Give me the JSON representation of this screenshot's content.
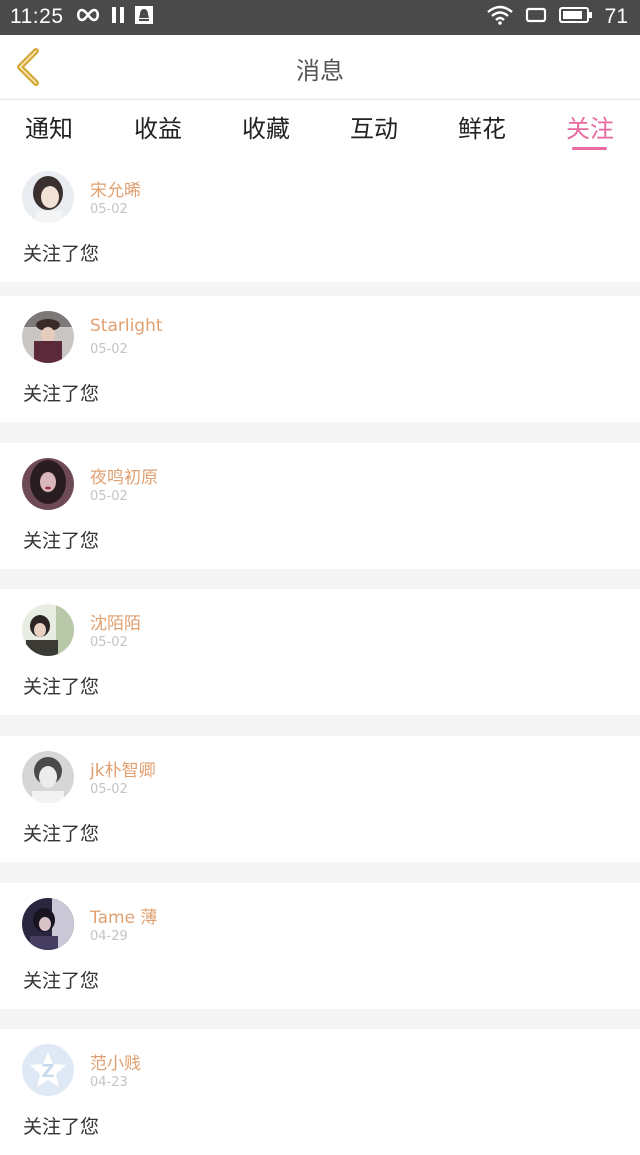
{
  "status_bar": {
    "time": "11:25",
    "battery_level": "71"
  },
  "header": {
    "title": "消息"
  },
  "tabs": [
    {
      "label": "通知"
    },
    {
      "label": "收益"
    },
    {
      "label": "收藏"
    },
    {
      "label": "互动"
    },
    {
      "label": "鲜花"
    },
    {
      "label": "关注",
      "active": true
    }
  ],
  "messages": [
    {
      "name": "宋允晞",
      "date": "05-02",
      "text": "关注了您"
    },
    {
      "name": "Starlight",
      "date": "05-02",
      "text": "关注了您"
    },
    {
      "name": "夜鸣初原",
      "date": "05-02",
      "text": "关注了您"
    },
    {
      "name": "沈陌陌",
      "date": "05-02",
      "text": "关注了您"
    },
    {
      "name": "jk朴智卿",
      "date": "05-02",
      "text": "关注了您"
    },
    {
      "name": "Tame 薄",
      "date": "04-29",
      "text": "关注了您"
    },
    {
      "name": "范小贱",
      "date": "04-23",
      "text": "关注了您"
    }
  ],
  "colors": {
    "accent": "#e86aa0",
    "username": "#e0a070",
    "back_arrow": "#d4a93a",
    "status_bar": "#4a4a4a"
  }
}
